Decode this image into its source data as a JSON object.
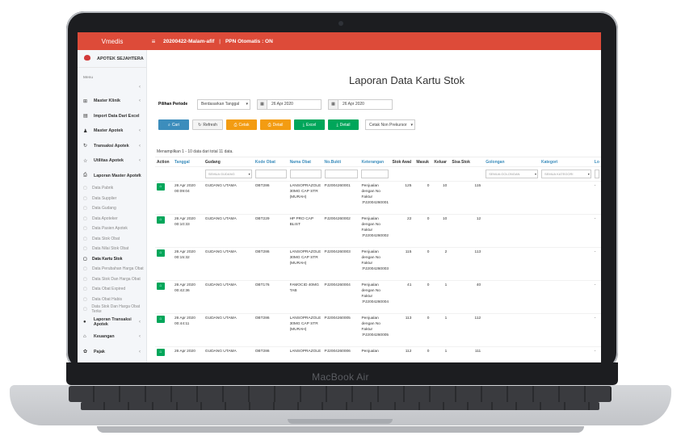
{
  "device": {
    "label": "MacBook Air"
  },
  "header": {
    "brand": "Vmedis",
    "menu_icon": "≡",
    "session": "20200422-Malam-afif",
    "separator": "|",
    "ppn": "PPN Otomatis : ON"
  },
  "sidebar": {
    "clinic_name": "APOTEK SEJAHTERA",
    "menu_label": "Menu",
    "items": [
      {
        "label": "Master Klinik",
        "icon": "plus-square-icon"
      },
      {
        "label": "Import Data Dari Excel",
        "icon": "file-icon"
      },
      {
        "label": "Master Apotek",
        "icon": "user-icon"
      },
      {
        "label": "Transaksi Apotek",
        "icon": "refresh-icon"
      },
      {
        "label": "Utilitas Apotek",
        "icon": "star-icon"
      },
      {
        "label": "Laporan Master Apotek",
        "icon": "print-icon"
      }
    ],
    "sub_items": [
      "Data Pabrik",
      "Data Supplier",
      "Data Gudang",
      "Data Apoteker",
      "Data Pasien Apotek",
      "Data Stok Obat",
      "Data Nilai Stok Obat",
      "Data Kartu Stok",
      "Data Perubahan Harga Obat",
      "Data Stok Dan Harga Obat",
      "Data Obat Expired",
      "Data Obat Habis",
      "Data Stok Dan Harga Obat Terke"
    ],
    "bottom_items": [
      {
        "label": "Laporan Transaksi Apotek",
        "icon": "circle-icon"
      },
      {
        "label": "Keuangan",
        "icon": "bank-icon"
      },
      {
        "label": "Pajak",
        "icon": "gear-icon"
      }
    ]
  },
  "page": {
    "title": "Laporan Data Kartu Stok",
    "period_label": "Pilihan Periode",
    "period_value": "Berdasarkan Tanggal",
    "date_from": "26 Apr 2020",
    "date_to": "26 Apr 2020",
    "buttons": {
      "cari": "Cari",
      "refresh": "Refresh",
      "cetak": "Cetak",
      "detail1": "Detail",
      "excel": "Excel",
      "detail2": "Detail"
    },
    "cetak_option": "Cetak Non Prekursor",
    "summary": "Menampilkan 1 - 10 data dari total 11 data."
  },
  "table": {
    "headers": [
      "Action",
      "Tanggal",
      "Gudang",
      "Kode Obat",
      "Nama Obat",
      "No.Bukti",
      "Keterangan",
      "Stok Awal",
      "Masuk",
      "Keluar",
      "Sisa Stok",
      "Golongan",
      "Kategori",
      "Lo"
    ],
    "filter_gudang": "SEMUA GUDANG",
    "filter_golongan": "SEMUA GOLONGAN",
    "filter_kategori": "SEMUA KATEGORI",
    "rows": [
      {
        "tanggal": "26 Apr 2020 00:09:04",
        "gudang": "GUDANG UTAMA",
        "kode": "OBT286",
        "nama": "LANSOPRAZOLE 30MG CAP STR (MURAH)",
        "bukti": "PJ2004260001",
        "ket": "Penjualan dengan No Faktur :PJ2004260001",
        "awal": "125",
        "masuk": "0",
        "keluar": "10",
        "sisa": "115",
        "lo": "-"
      },
      {
        "tanggal": "26 Apr 2020 00:10:33",
        "gudang": "GUDANG UTAMA",
        "kode": "OBT229",
        "nama": "HP PRO CAP BLIST",
        "bukti": "PJ2004260002",
        "ket": "Penjualan dengan No Faktur :PJ2004260002",
        "awal": "22",
        "masuk": "0",
        "keluar": "10",
        "sisa": "12",
        "lo": "-"
      },
      {
        "tanggal": "26 Apr 2020 00:15:32",
        "gudang": "GUDANG UTAMA",
        "kode": "OBT286",
        "nama": "LANSOPRAZOLE 30MG CAP STR (MURAH)",
        "bukti": "PJ2004260003",
        "ket": "Penjualan dengan No Faktur :PJ2004260003",
        "awal": "115",
        "masuk": "0",
        "keluar": "2",
        "sisa": "113",
        "lo": "-"
      },
      {
        "tanggal": "26 Apr 2020 00:42:36",
        "gudang": "GUDANG UTAMA",
        "kode": "OBT176",
        "nama": "FAMOCID 40MG TAB",
        "bukti": "PJ2004260004",
        "ket": "Penjualan dengan No Faktur :PJ2004260004",
        "awal": "41",
        "masuk": "0",
        "keluar": "1",
        "sisa": "40",
        "lo": "-"
      },
      {
        "tanggal": "26 Apr 2020 00:44:11",
        "gudang": "GUDANG UTAMA",
        "kode": "OBT286",
        "nama": "LANSOPRAZOLE 30MG CAP STR (MURAH)",
        "bukti": "PJ2004260005",
        "ket": "Penjualan dengan No Faktur :PJ2004260005",
        "awal": "113",
        "masuk": "0",
        "keluar": "1",
        "sisa": "112",
        "lo": "-"
      },
      {
        "tanggal": "26 Apr 2020",
        "gudang": "GUDANG UTAMA",
        "kode": "OBT286",
        "nama": "LANSOPRAZOLE",
        "bukti": "PJ2004260006",
        "ket": "Penjualan",
        "awal": "112",
        "masuk": "0",
        "keluar": "1",
        "sisa": "111",
        "lo": "-"
      }
    ]
  }
}
